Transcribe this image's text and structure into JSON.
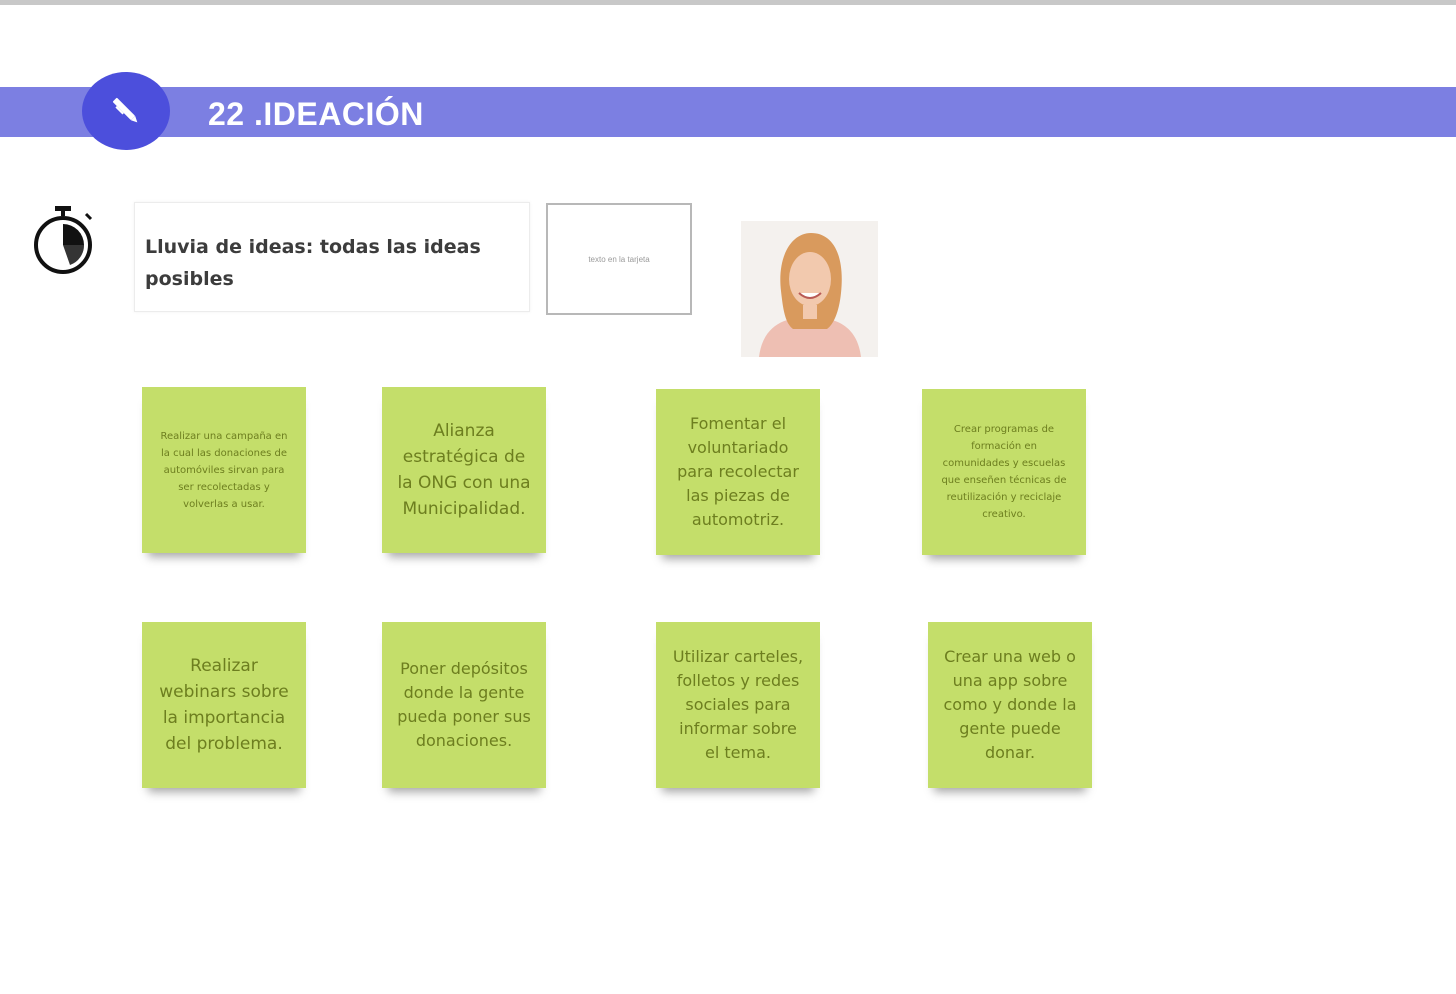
{
  "header": {
    "title": "22 .IDEACIÓN",
    "icon": "pencil-icon",
    "band_color": "#7c7fe2",
    "circle_color": "#4c4fdc"
  },
  "timer": {
    "icon": "stopwatch-icon"
  },
  "prompt": {
    "text": "Lluvia de ideas: todas las ideas posibles"
  },
  "small_box": {
    "text": "texto en la tarjeta"
  },
  "avatar": {
    "icon": "person-photo"
  },
  "notes": [
    {
      "text": "Realizar una campaña en la cual las donaciones de automóviles sirvan para ser recolectadas y volverlas a usar."
    },
    {
      "text": "Alianza estratégica de la ONG con una Municipalidad."
    },
    {
      "text": "Fomentar el voluntariado para recolectar las piezas de automotriz."
    },
    {
      "text": "Crear programas de formación en comunidades y escuelas que enseñen técnicas de reutilización y reciclaje creativo."
    },
    {
      "text": "Realizar webinars sobre la importancia del problema."
    },
    {
      "text": "Poner depósitos donde la gente pueda poner sus donaciones."
    },
    {
      "text": "Utilizar carteles, folletos y redes sociales para informar sobre el tema."
    },
    {
      "text": "Crear una web o una app sobre como y donde la gente puede donar."
    }
  ],
  "note_color": "#c4de6a"
}
